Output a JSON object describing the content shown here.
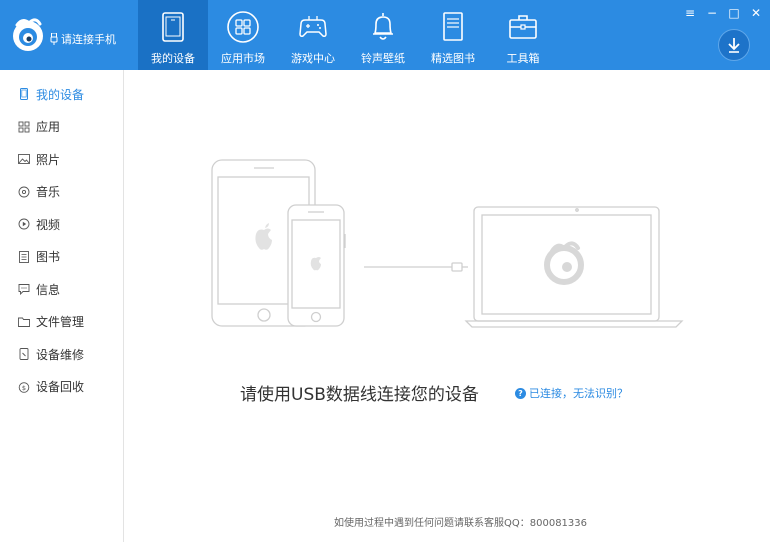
{
  "app": {
    "connect_status": "请连接手机"
  },
  "tabs": [
    {
      "label": "我的设备",
      "active": true
    },
    {
      "label": "应用市场",
      "active": false
    },
    {
      "label": "游戏中心",
      "active": false
    },
    {
      "label": "铃声壁纸",
      "active": false
    },
    {
      "label": "精选图书",
      "active": false
    },
    {
      "label": "工具箱",
      "active": false
    }
  ],
  "window_controls": {
    "menu": "≡",
    "minimize": "−",
    "maximize": "□",
    "close": "✕"
  },
  "sidebar": {
    "items": [
      {
        "label": "我的设备",
        "icon": "phone-icon",
        "active": true
      },
      {
        "label": "应用",
        "icon": "apps-grid-icon",
        "active": false
      },
      {
        "label": "照片",
        "icon": "photo-icon",
        "active": false
      },
      {
        "label": "音乐",
        "icon": "music-icon",
        "active": false
      },
      {
        "label": "视频",
        "icon": "video-icon",
        "active": false
      },
      {
        "label": "图书",
        "icon": "book-icon",
        "active": false
      },
      {
        "label": "信息",
        "icon": "message-icon",
        "active": false
      },
      {
        "label": "文件管理",
        "icon": "folder-icon",
        "active": false
      },
      {
        "label": "设备维修",
        "icon": "repair-icon",
        "active": false
      },
      {
        "label": "设备回收",
        "icon": "recycle-icon",
        "active": false
      }
    ]
  },
  "main": {
    "prompt": "请使用USB数据线连接您的设备",
    "help_link": "已连接，无法识别？",
    "footer": "如使用过程中遇到任何问题请联系客服QQ：800081336"
  },
  "colors": {
    "brand": "#2c8be2",
    "tab_active": "#1a71c5"
  }
}
